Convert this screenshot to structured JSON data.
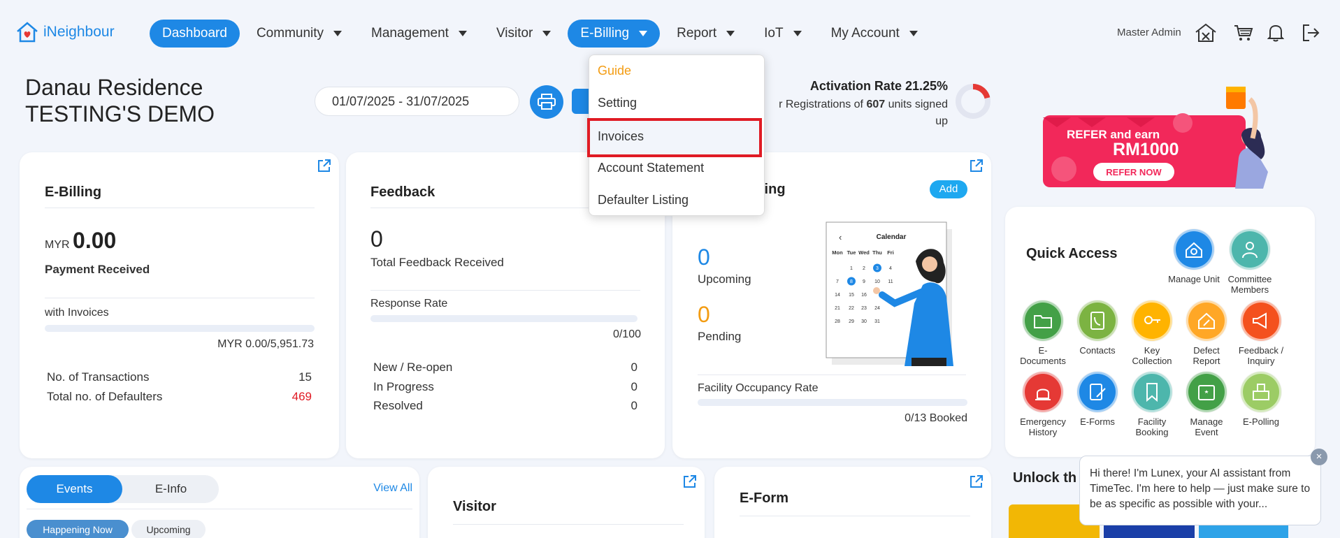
{
  "app": {
    "name": "iNeighbour"
  },
  "nav": {
    "items": [
      {
        "label": "Dashboard",
        "active": true,
        "caret": false
      },
      {
        "label": "Community",
        "caret": true
      },
      {
        "label": "Management",
        "caret": true
      },
      {
        "label": "Visitor",
        "caret": true
      },
      {
        "label": "E-Billing",
        "active": true,
        "caret": true
      },
      {
        "label": "Report",
        "caret": true
      },
      {
        "label": "IoT",
        "caret": true
      },
      {
        "label": "My Account",
        "caret": true
      }
    ],
    "user": "Master Admin"
  },
  "dropdown": {
    "items": [
      "Guide",
      "Setting",
      "Invoices",
      "Account Statement",
      "Defaulter Listing"
    ],
    "highlighted": "Invoices"
  },
  "header": {
    "title_line1": "Danau Residence",
    "title_line2": "TESTING'S DEMO",
    "date_range": "01/07/2025 - 31/07/2025",
    "activation_title": "Activation Rate 21.25%",
    "activation_pre": "r Registrations of",
    "activation_units": "607",
    "activation_post": "units signed",
    "activation_last": "up",
    "activation_rate": 21.25
  },
  "banner": {
    "line1": "REFER and earn",
    "line2": "RM1000",
    "button": "REFER NOW"
  },
  "ebilling": {
    "title": "E-Billing",
    "currency": "MYR",
    "amount": "0.00",
    "payment_label": "Payment Received",
    "invoices_label": "with Invoices",
    "invoices_value": "MYR 0.00/5,951.73",
    "transactions_label": "No. of Transactions",
    "transactions_value": "15",
    "defaulters_label": "Total no. of Defaulters",
    "defaulters_value": "469"
  },
  "feedback": {
    "title": "Feedback",
    "count": "0",
    "count_label": "Total Feedback Received",
    "response_label": "Response Rate",
    "response_value": "0/100",
    "rows": [
      {
        "label": "New / Re-open",
        "value": "0"
      },
      {
        "label": "In Progress",
        "value": "0"
      },
      {
        "label": "Resolved",
        "value": "0"
      }
    ]
  },
  "booking": {
    "title_partial": "ooking",
    "add_label": "Add",
    "upcoming_count": "0",
    "upcoming_label": "Upcoming",
    "pending_count": "0",
    "pending_label": "Pending",
    "occupancy_label": "Facility Occupancy Rate",
    "occupancy_value": "0/13 Booked",
    "calendar_title": "Calendar",
    "calendar_back": "‹",
    "calendar_days": [
      "Mon",
      "Tue",
      "Wed",
      "Thu",
      "Fri"
    ],
    "calendar_dates": [
      [
        "",
        "1",
        "2",
        "3",
        "4"
      ],
      [
        "7",
        "8",
        "9",
        "10",
        "11"
      ],
      [
        "14",
        "15",
        "16",
        "",
        ""
      ],
      [
        "21",
        "22",
        "23",
        "24",
        ""
      ],
      [
        "28",
        "29",
        "30",
        "31",
        ""
      ]
    ]
  },
  "quick_access": {
    "title": "Quick Access",
    "items": [
      {
        "label": "Manage Unit",
        "color": "#1e88e5",
        "icon": "home-gear-icon"
      },
      {
        "label": "Committee Members",
        "color": "#4db6ac",
        "icon": "person-icon"
      },
      {
        "label": "E-Documents",
        "color": "#43a047",
        "icon": "folder-icon"
      },
      {
        "label": "Contacts",
        "color": "#7cb342",
        "icon": "phone-book-icon"
      },
      {
        "label": "Key Collection",
        "color": "#ffb300",
        "icon": "key-icon"
      },
      {
        "label": "Defect Report",
        "color": "#ffa726",
        "icon": "house-wrench-icon"
      },
      {
        "label": "Feedback / Inquiry",
        "color": "#f4511e",
        "icon": "megaphone-icon"
      },
      {
        "label": "Emergency History",
        "color": "#e53935",
        "icon": "siren-icon"
      },
      {
        "label": "E-Forms",
        "color": "#1e88e5",
        "icon": "form-pen-icon"
      },
      {
        "label": "Facility Booking",
        "color": "#4db6ac",
        "icon": "bookmark-icon"
      },
      {
        "label": "Manage Event",
        "color": "#43a047",
        "icon": "calendar-star-icon"
      },
      {
        "label": "E-Polling",
        "color": "#9ccc65",
        "icon": "ballot-icon"
      }
    ]
  },
  "events": {
    "tabs": [
      "Events",
      "E-Info"
    ],
    "view_all": "View All",
    "pills": [
      "Happening Now",
      "Upcoming"
    ]
  },
  "visitor": {
    "title": "Visitor"
  },
  "eform": {
    "title": "E-Form"
  },
  "unlock": {
    "title_partial": "Unlock th"
  },
  "chat": {
    "message": "Hi there! I'm Lunex, your AI assistant from TimeTec. I'm here to help — just make sure to be as specific as possible with your...",
    "close": "×"
  },
  "colors": {
    "primary": "#1e88e5",
    "danger": "#e01b24",
    "orange": "#f39c12"
  }
}
